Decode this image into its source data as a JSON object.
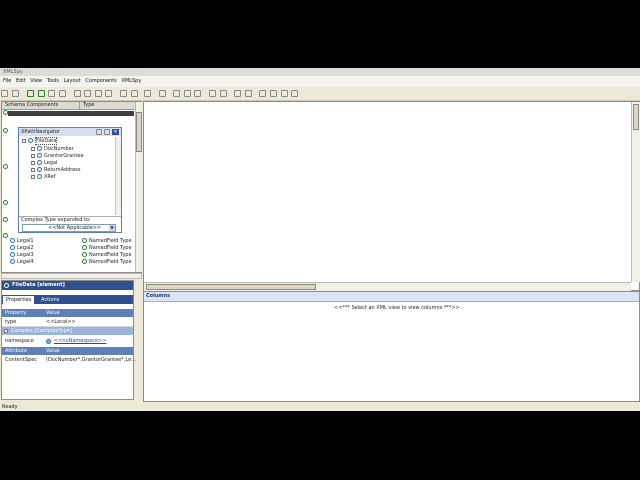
{
  "window": {
    "title": "XMLSpy"
  },
  "menu": {
    "items": [
      "File",
      "Edit",
      "View",
      "Tools",
      "Layout",
      "Components",
      "XMLSpy"
    ]
  },
  "left_panel": {
    "headers": [
      "Schema Components",
      "Type"
    ],
    "popup": {
      "title": "XPathNavigator",
      "tree_root": "FileData",
      "tree_children": [
        "DocNumber",
        "GrantorGrantee",
        "Legal",
        "ReturnAddress",
        "XRef"
      ],
      "label": "Complex Type expanded to:",
      "select_value": "<<Not Applicable>>"
    },
    "rows": [
      {
        "name": "Legal1",
        "type": "NamedField Type"
      },
      {
        "name": "Legal2",
        "type": "NamedField Type"
      },
      {
        "name": "Legal3",
        "type": "NamedField Type"
      },
      {
        "name": "Legal4",
        "type": "NamedField Type"
      }
    ]
  },
  "properties_panel": {
    "title": "FileData [element]",
    "tabs": [
      "Properties",
      "Actions"
    ],
    "col_headers": [
      "Property",
      "Value"
    ],
    "type_row": {
      "label": "type",
      "value": "<<Local>>"
    },
    "complex_header": "Complex [ComplexType]",
    "namespace": {
      "label": "namespace",
      "value": "<<noNamespace>>"
    },
    "col_headers2": [
      "Attribute",
      "Value"
    ],
    "content_spec": {
      "label": "ContentSpec",
      "value": "(DocNumber*,GrantorGrantee*,Le..."
    }
  },
  "columns_panel": {
    "title": "Columns",
    "message": "<<*** Select an XML view to view columns ***>>"
  },
  "status": {
    "text": "Ready"
  }
}
